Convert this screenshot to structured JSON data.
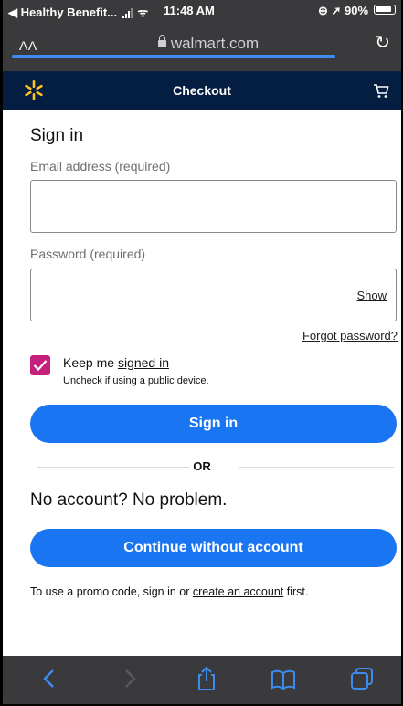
{
  "status_bar": {
    "back_app": "◀ Healthy Benefit...",
    "time": "11:48 AM",
    "battery_text": "⊕ ➚ 90%",
    "battery_level": 0.9
  },
  "browser": {
    "text_size_label": "AA",
    "url": "walmart.com",
    "reload_icon": "reload-icon",
    "load_progress": 0.85
  },
  "header": {
    "title": "Checkout",
    "logo_icon": "walmart-spark-icon",
    "cart_icon": "cart-icon",
    "brand_color": "#041e42",
    "spark_color": "#ffc220"
  },
  "form": {
    "title": "Sign in",
    "email_label": "Email address (required)",
    "email_value": "",
    "password_label": "Password (required)",
    "password_value": "",
    "show_label": "Show",
    "forgot_label": "Forgot password?",
    "keep_prefix": "Keep me ",
    "keep_link": "signed in",
    "keep_checked": true,
    "uncheck_hint": "Uncheck if using a public device.",
    "signin_button": "Sign in",
    "or_label": "OR",
    "no_account": "No account? No problem.",
    "continue_button": "Continue without account",
    "promo_prefix": "To use a promo code, sign in or ",
    "promo_link": "create an account",
    "promo_suffix": " first.",
    "accent_color": "#1a75f2",
    "checkbox_color": "#c4217f"
  },
  "toolbar": {
    "back_icon": "back-chevron-icon",
    "forward_icon": "forward-chevron-icon",
    "share_icon": "share-icon",
    "bookmarks_icon": "bookmarks-icon",
    "tabs_icon": "tabs-icon"
  }
}
